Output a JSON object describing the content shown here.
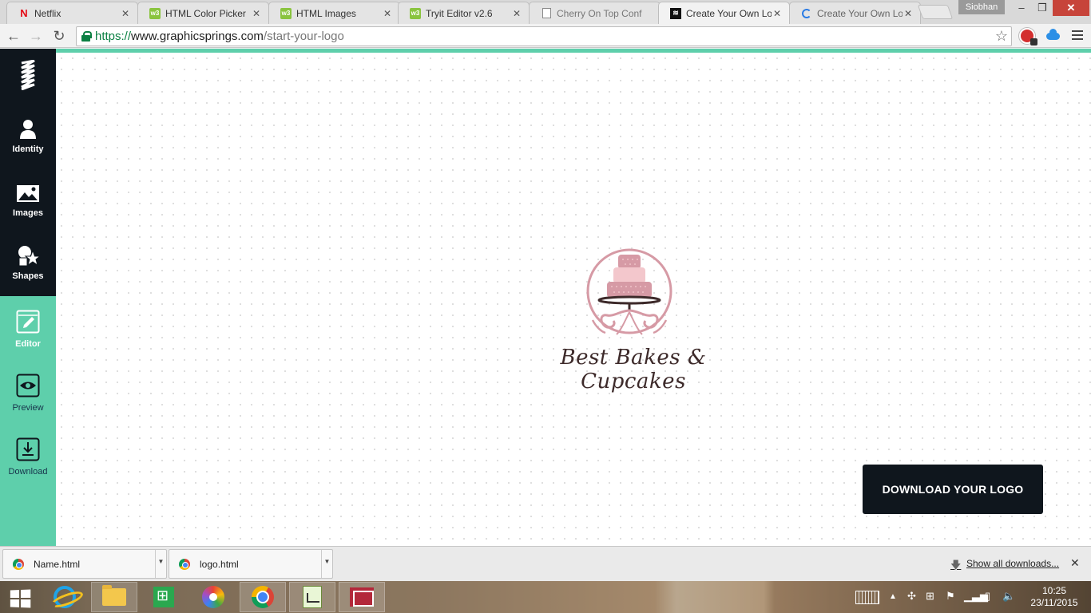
{
  "browser": {
    "tabs": [
      {
        "title": "Netflix",
        "favicon": "netflix-icon"
      },
      {
        "title": "HTML Color Picker",
        "favicon": "w3schools-icon"
      },
      {
        "title": "HTML Images",
        "favicon": "w3schools-icon"
      },
      {
        "title": "Tryit Editor v2.6",
        "favicon": "w3schools-icon"
      },
      {
        "title": "Cherry On Top Conf",
        "favicon": "document-icon"
      },
      {
        "title": "Create Your Own Lo",
        "favicon": "graphicsprings-icon",
        "active": true
      },
      {
        "title": "Create Your Own Lo",
        "favicon": "loading-icon"
      }
    ],
    "profile_name": "Siobhan",
    "url": {
      "scheme": "https://",
      "host": "www.graphicsprings.com",
      "path": "/start-your-logo"
    }
  },
  "sidebar": {
    "items": [
      {
        "label": "Identity",
        "icon": "user-icon"
      },
      {
        "label": "Images",
        "icon": "image-icon"
      },
      {
        "label": "Shapes",
        "icon": "shapes-icon"
      },
      {
        "label": "Editor",
        "icon": "pencil-icon",
        "current": true
      },
      {
        "label": "Preview",
        "icon": "eye-icon"
      },
      {
        "label": "Download",
        "icon": "download-icon"
      }
    ],
    "colors": {
      "dark": "#0f161d",
      "accent": "#5ecfab"
    }
  },
  "logo": {
    "text": "Best Bakes & Cupcakes",
    "emblem": "cake-emblem",
    "colors": {
      "pink": "#d69aa5",
      "light_pink": "#f3c7cc",
      "brown": "#3d2a2a"
    }
  },
  "canvas": {
    "download_button": "DOWNLOAD YOUR LOGO"
  },
  "downloads": {
    "items": [
      {
        "name": "Name.html"
      },
      {
        "name": "logo.html"
      }
    ],
    "show_all": "Show all downloads..."
  },
  "taskbar": {
    "apps": [
      "internet-explorer-icon",
      "file-explorer-icon",
      "store-icon",
      "picasa-icon",
      "chrome-icon",
      "notepad-icon",
      "news-icon"
    ],
    "time": "10:25",
    "date": "23/11/2015"
  }
}
